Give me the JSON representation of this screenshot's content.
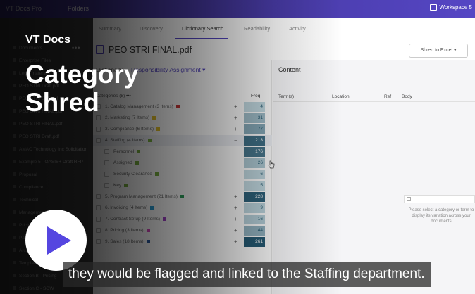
{
  "topbar": {
    "brand": "VT Docs Pro",
    "folders": "Folders",
    "workspace": "Workspace 5"
  },
  "tabs": [
    {
      "label": "Summary"
    },
    {
      "label": "Discovery"
    },
    {
      "label": "Dictionary Search"
    },
    {
      "label": "Readability"
    },
    {
      "label": "Activity"
    }
  ],
  "document": {
    "title": "PEO STRI FINAL.pdf",
    "shred_button": "Shred to Excel"
  },
  "sidebar": {
    "items": [
      {
        "label": "Documents"
      },
      {
        "label": "Enterprise Files"
      },
      {
        "label": "Legal materials"
      },
      {
        "label": "PEO STRI Draft.pdf"
      },
      {
        "label": "PEO STRI SEP.pdf"
      },
      {
        "label": "PEO STRI FINAL.pdf"
      },
      {
        "label": "PEO STRI FINAL.pdf"
      },
      {
        "label": "PEO STRI Draft.pdf"
      },
      {
        "label": "AMAC Technology Inc Solicitation"
      },
      {
        "label": "Example 5 - OASIS+ Draft RFP"
      },
      {
        "label": "Proposal"
      },
      {
        "label": "Compliance"
      },
      {
        "label": "Technical"
      },
      {
        "label": "Management"
      },
      {
        "label": "Pricing"
      },
      {
        "label": "Past Performance"
      },
      {
        "label": "Archive"
      },
      {
        "label": "Templates"
      },
      {
        "label": "Section B - Pricing"
      },
      {
        "label": "Section C - SOW"
      }
    ]
  },
  "dictionary": {
    "label": "Dictionary",
    "selected": "Responsibility Assignment",
    "categories_header": "Categories (8)",
    "freq_header": "Freq",
    "rows": [
      {
        "label": "1. Catalog Management (3 Items)",
        "color": "#d03a3a",
        "freq": "4",
        "level": 0,
        "intensity": 0.1
      },
      {
        "label": "2. Marketing (7 Items)",
        "color": "#e8c42a",
        "freq": "31",
        "level": 0,
        "intensity": 0.3
      },
      {
        "label": "3. Compliance (6 Items)",
        "color": "#e8c42a",
        "freq": "77",
        "level": 0,
        "intensity": 0.45
      },
      {
        "label": "4. Staffing (4 Items)",
        "color": "#7cb342",
        "freq": "213",
        "level": 0,
        "intensity": 0.85,
        "expanded": true
      },
      {
        "label": "Personnel",
        "color": "#7cb342",
        "freq": "176",
        "level": 1,
        "intensity": 0.8
      },
      {
        "label": "Assigned",
        "color": "#7cb342",
        "freq": "26",
        "level": 1,
        "intensity": 0.22
      },
      {
        "label": "Security Clearance",
        "color": "#7cb342",
        "freq": "6",
        "level": 1,
        "intensity": 0.12
      },
      {
        "label": "Key",
        "color": "#7cb342",
        "freq": "5",
        "level": 1,
        "intensity": 0.1
      },
      {
        "label": "5. Program Management (21 Items)",
        "color": "#2e9e5b",
        "freq": "228",
        "level": 0,
        "intensity": 0.95
      },
      {
        "label": "6. Invoicing (4 Items)",
        "color": "#2b9fd6",
        "freq": "9",
        "level": 0,
        "intensity": 0.14
      },
      {
        "label": "7. Contract Setup (9 Items)",
        "color": "#a142c9",
        "freq": "16",
        "level": 0,
        "intensity": 0.18
      },
      {
        "label": "8. Pricing (3 Items)",
        "color": "#d94ac1",
        "freq": "44",
        "level": 0,
        "intensity": 0.38
      },
      {
        "label": "9. Sales (18 Items)",
        "color": "#2c5aa0",
        "freq": "261",
        "level": 0,
        "intensity": 1.0
      }
    ]
  },
  "content": {
    "title": "Content",
    "columns": [
      "Term(s)",
      "Location",
      "Ref",
      "Body"
    ],
    "empty_message": "Please select a category or term to display its variation across your documents"
  },
  "overlay": {
    "brand": "VT Docs",
    "title": "Category Shred",
    "caption": "they would be flagged and linked to the Staffing department."
  }
}
